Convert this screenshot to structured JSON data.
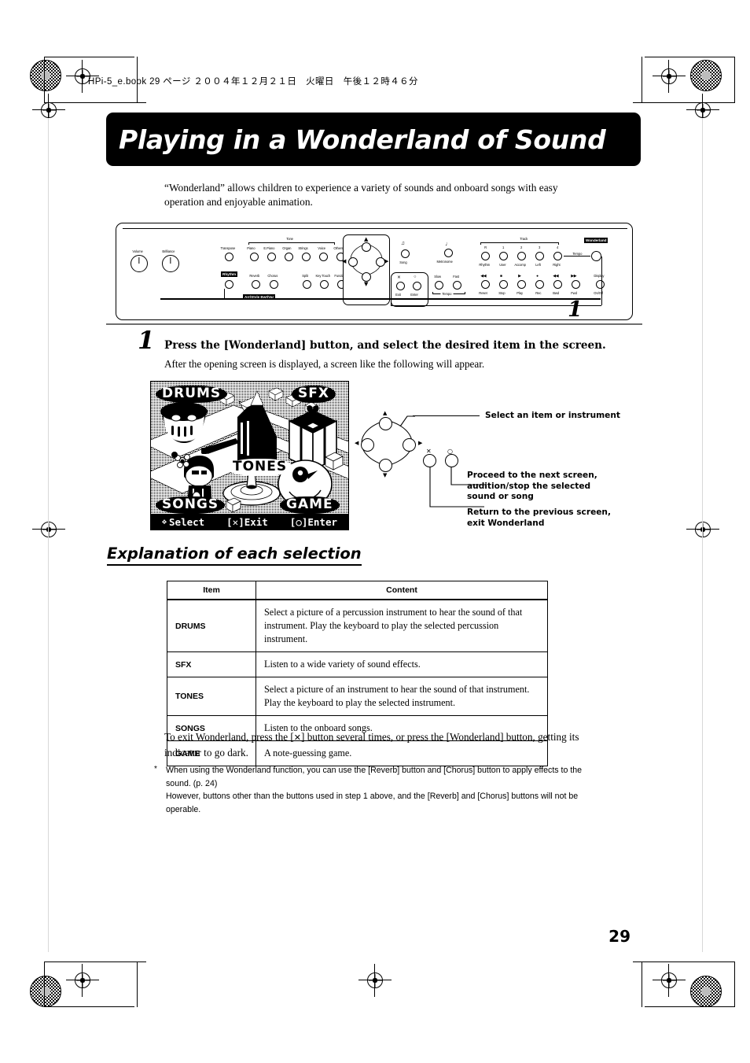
{
  "print": {
    "book_line": "HPi-5_e.book  29 ページ  ２００４年１２月２１日　火曜日　午後１２時４６分"
  },
  "title": "Playing in a Wonderland of Sound",
  "intro": "“Wonderland” allows children to experience a variety of sounds and onboard songs with easy operation and enjoyable animation.",
  "panel": {
    "callout_number": "1",
    "labels": {
      "volume": "Volume",
      "brilliance": "Brilliance",
      "transpose": "Transpose",
      "tone_group": "Tone",
      "piano": "Piano",
      "e_piano": "E.Piano",
      "organ": "Organ",
      "strings": "Strings",
      "voice": "Voice",
      "others": "Others",
      "rhythm": "Rhythm",
      "reverb": "Reverb",
      "chorus": "Chorus",
      "split": "Split",
      "key_touch": "Key Touch",
      "function": "Function",
      "arr_style_variation": "Arr/Style  Bwt/Var",
      "song": "Song",
      "exit": "Exit",
      "enter": "Enter",
      "metronome": "Metronome",
      "slow": "Slow",
      "fast": "Fast",
      "tempo": "Tempo",
      "track_group": "Track",
      "track_r": "R",
      "track_1": "1",
      "track_2": "2",
      "track_3": "3",
      "track_4": "4",
      "rhythm_track": "Rhythm",
      "user": "User",
      "accomp": "Accomp",
      "left": "Left",
      "right": "Right",
      "reset": "Reset",
      "stop": "Stop",
      "play": "Play",
      "rec": "Rec",
      "bwd": "Bwd",
      "fwd": "Fwd",
      "display": "Display",
      "display_onoff": "On/Off",
      "tempo_knob": "Tempo",
      "wonderland": "Wonderland"
    }
  },
  "step": {
    "number": "1",
    "heading": "Press the [Wonderland] button, and select the desired item in the screen.",
    "sub": "After the opening screen is displayed, a screen like the following will appear."
  },
  "lcd": {
    "items": {
      "drums": "DRUMS",
      "sfx": "SFX",
      "tones": "TONES",
      "songs": "SONGS",
      "game": "GAME"
    },
    "bottom_bar": {
      "select": "Select",
      "exit": "[✕]Exit",
      "enter": "[○]Enter"
    }
  },
  "callouts": {
    "select_item": "Select an item or instrument",
    "proceed": "Proceed to the next screen, audition/stop the selected sound or song",
    "return": "Return to the previous screen, exit Wonderland",
    "x_mark": "✕",
    "o_mark": "○"
  },
  "section_heading": "Explanation of each selection",
  "table": {
    "headers": [
      "Item",
      "Content"
    ],
    "rows": [
      {
        "item": "DRUMS",
        "content": "Select a picture of a percussion instrument to hear the sound of that instrument. Play the keyboard to play the selected percussion instrument."
      },
      {
        "item": "SFX",
        "content": "Listen to a wide variety of sound effects."
      },
      {
        "item": "TONES",
        "content": "Select a picture of an instrument to hear the sound of that instrument. Play the keyboard to play the selected instrument."
      },
      {
        "item": "SONGS",
        "content": "Listen to the onboard songs."
      },
      {
        "item": "GAME",
        "content": "A note-guessing game."
      }
    ]
  },
  "closing": {
    "exit_text_before": "To exit Wonderland, press the [",
    "exit_glyph": "✕",
    "exit_text_after": "] button several times, or press the [Wonderland] button, getting its indicator to go dark.",
    "note_star": "*",
    "note_line1": "When using the Wonderland function, you can use the [Reverb] button and [Chorus] button to apply effects to the sound. (p. 24)",
    "note_line2": "However, buttons other than the buttons used in step 1 above, and the [Reverb] and [Chorus] buttons will not be operable."
  },
  "page_number": "29"
}
